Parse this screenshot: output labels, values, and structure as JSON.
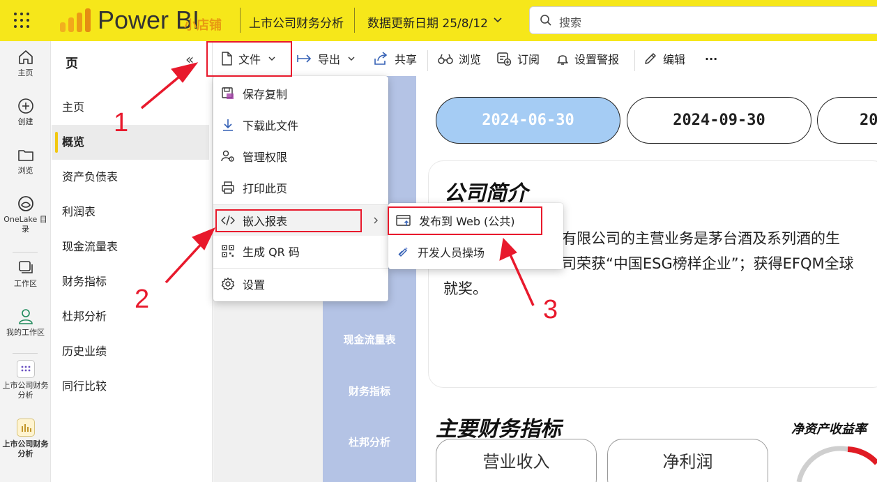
{
  "topbar": {
    "brand": "Power BI",
    "brand_sub": "小店铺",
    "report_title": "上市公司财务分析",
    "update_date": "数据更新日期 25/8/12",
    "search_placeholder": "搜索",
    "brand_color": "#f6e71a"
  },
  "rail": {
    "items": [
      {
        "label": "主页",
        "icon": "home-icon"
      },
      {
        "label": "创建",
        "icon": "plus-circle-icon"
      },
      {
        "label": "浏览",
        "icon": "folder-icon"
      },
      {
        "label": "OneLake 目录",
        "icon": "onelake-icon"
      },
      {
        "label": "工作区",
        "icon": "workspaces-icon"
      },
      {
        "label": "我的工作区",
        "icon": "person-icon"
      },
      {
        "label": "上市公司财务分析",
        "icon": "app-grid-icon"
      },
      {
        "label": "上市公司财务分析",
        "icon": "report-chart-icon"
      }
    ]
  },
  "pages": {
    "title": "页",
    "collapse_label": "«",
    "items": [
      "主页",
      "概览",
      "资产负债表",
      "利润表",
      "现金流量表",
      "财务指标",
      "杜邦分析",
      "历史业绩",
      "同行比较"
    ],
    "active_index": 1
  },
  "toolbar": {
    "file": "文件",
    "export": "导出",
    "share": "共享",
    "browse": "浏览",
    "subscribe": "订阅",
    "alert": "设置警报",
    "edit": "编辑",
    "more": "···"
  },
  "file_menu": {
    "items": [
      {
        "label": "保存复制",
        "icon": "save-copy-icon"
      },
      {
        "label": "下载此文件",
        "icon": "download-icon"
      },
      {
        "label": "管理权限",
        "icon": "manage-permissions-icon"
      },
      {
        "label": "打印此页",
        "icon": "print-icon"
      },
      {
        "label": "嵌入报表",
        "icon": "embed-code-icon"
      },
      {
        "label": "生成 QR 码",
        "icon": "qr-code-icon"
      },
      {
        "label": "设置",
        "icon": "settings-icon"
      }
    ]
  },
  "embed_submenu": {
    "items": [
      {
        "label": "发布到 Web (公共)",
        "icon": "publish-web-icon"
      },
      {
        "label": "开发人员操场",
        "icon": "developer-icon"
      }
    ]
  },
  "report": {
    "nav_items": [
      "现金流量表",
      "财务指标",
      "杜邦分析"
    ],
    "dates": [
      "2024-06-30",
      "2024-09-30",
      "20"
    ],
    "active_date_index": 0,
    "intro_title": "公司简介",
    "intro_lines": [
      "有限公司的主营业务是茅台酒及系列酒的生",
      "司荣获“中国ESG榜样企业”；获得EFQM全球",
      "就奖。"
    ],
    "kpi_title": "主要财务指标",
    "roe_title": "净资产收益率",
    "kpis": [
      "营业收入",
      "净利润"
    ],
    "accent_color": "#a5ccf4",
    "nav_color": "#b4c3e5"
  },
  "annotations": {
    "numbers": [
      "1",
      "2",
      "3"
    ],
    "color": "#e8192c"
  }
}
